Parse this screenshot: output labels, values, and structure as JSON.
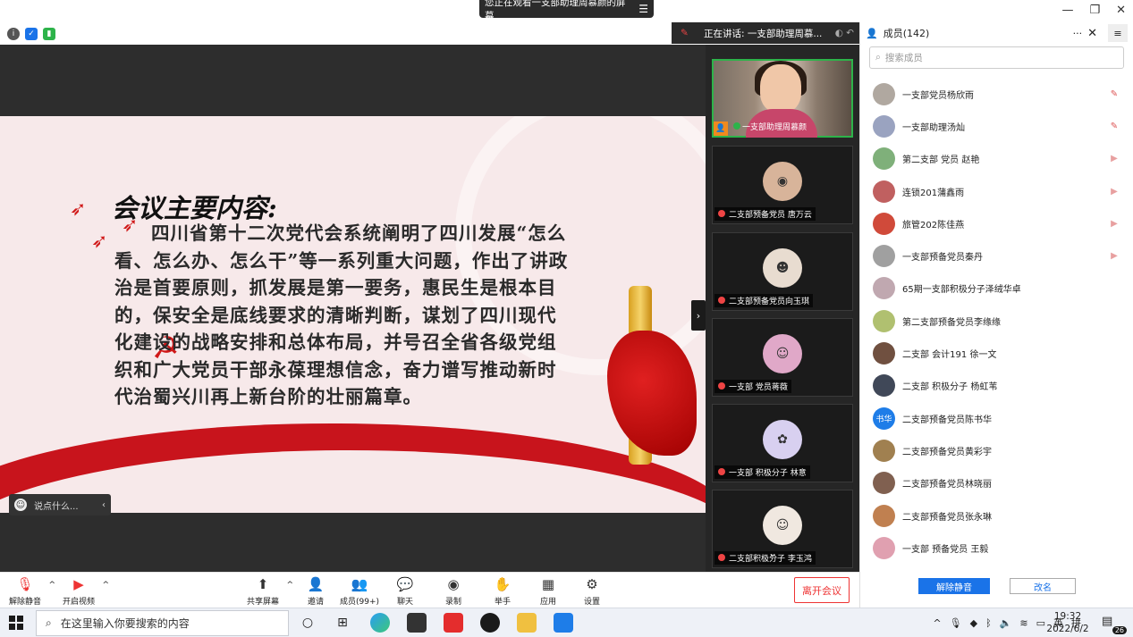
{
  "banner": {
    "viewing_text": "您正在观看一支部助理周慕颜的屏幕",
    "menu_icon": "menu-icon"
  },
  "window": {
    "minimize": "—",
    "restore": "❐",
    "close": "✕"
  },
  "speaking": {
    "text": "正在讲话: 一支部助理周慕..."
  },
  "slide": {
    "title": "会议主要内容:",
    "body": "四川省第十二次党代会系统阐明了四川发展“怎么看、怎么办、怎么干”等一系列重大问题，作出了讲政治是首要原则，抓发展是第一要务，惠民生是根本目的，保安全是底线要求的清晰判断，谋划了四川现代化建设的战略安排和总体布局，并号召全省各级党组织和广大党员干部永葆理想信念，奋力谱写推动新时代治蜀兴川再上新台阶的壮丽篇章。"
  },
  "chat_pill": {
    "placeholder": "说点什么..."
  },
  "gallery": {
    "tiles": [
      {
        "name": "一支部助理周慕颜",
        "active": true
      },
      {
        "name": "二支部预备党员 唐万云",
        "active": false
      },
      {
        "name": "二支部预备党员向玉琪",
        "active": false
      },
      {
        "name": "一支部 党员蒋薇",
        "active": false
      },
      {
        "name": "一支部 积极分子 林意",
        "active": false
      },
      {
        "name": "二支部积极分子 李玉鸿",
        "active": false
      }
    ]
  },
  "panel": {
    "title": "成员(142)",
    "more": "···",
    "close": "✕",
    "search_placeholder": "搜索成员",
    "members": [
      {
        "name": "一支部党员杨欣雨",
        "status": "mic-off",
        "color": "#b0a8a0"
      },
      {
        "name": "一支部助理汤灿",
        "status": "mic-off",
        "color": "#9aa3c0"
      },
      {
        "name": "第二支部  党员 赵艳",
        "status": "cam-off",
        "color": "#7fb07a"
      },
      {
        "name": "连锁201蒲鑫雨",
        "status": "cam-off",
        "color": "#c06060"
      },
      {
        "name": "旅管202陈佳燕",
        "status": "cam-off",
        "color": "#d04a3a"
      },
      {
        "name": "一支部预备党员秦丹",
        "status": "cam-off",
        "color": "#a0a0a0"
      },
      {
        "name": "65期一支部积极分子泽绒华卓",
        "status": "",
        "color": "#c0a8b0"
      },
      {
        "name": "第二支部预备党员李缘缘",
        "status": "",
        "color": "#b0c070"
      },
      {
        "name": "二支部 会计191 徐一文",
        "status": "",
        "color": "#705040"
      },
      {
        "name": "二支部 积极分子 杨虹苇",
        "status": "",
        "color": "#404858"
      },
      {
        "name": "二支部预备党员陈书华",
        "status": "",
        "color": "#1e7de8",
        "initials": "书华"
      },
      {
        "name": "二支部预备党员黄彩宇",
        "status": "",
        "color": "#a08050"
      },
      {
        "name": "二支部预备党员林晓丽",
        "status": "",
        "color": "#806050"
      },
      {
        "name": "二支部预备党员张永琳",
        "status": "",
        "color": "#c08050"
      },
      {
        "name": "一支部  预备党员  王毅",
        "status": "",
        "color": "#e0a0b0"
      }
    ],
    "unmute_all": "解除静音",
    "rename": "改名"
  },
  "toolbar": {
    "unmute": "解除静音",
    "start_video": "开启视频",
    "share": "共享屏幕",
    "invite": "邀请",
    "members": "成员(99+)",
    "chat": "聊天",
    "record": "录制",
    "raise_hand": "举手",
    "apps": "应用",
    "settings": "设置",
    "leave": "离开会议"
  },
  "taskbar": {
    "search_placeholder": "在这里输入你要搜索的内容",
    "ime": "英",
    "ime2": "拼",
    "time": "19:32",
    "date": "2022/6/2",
    "notify_count": "26"
  }
}
